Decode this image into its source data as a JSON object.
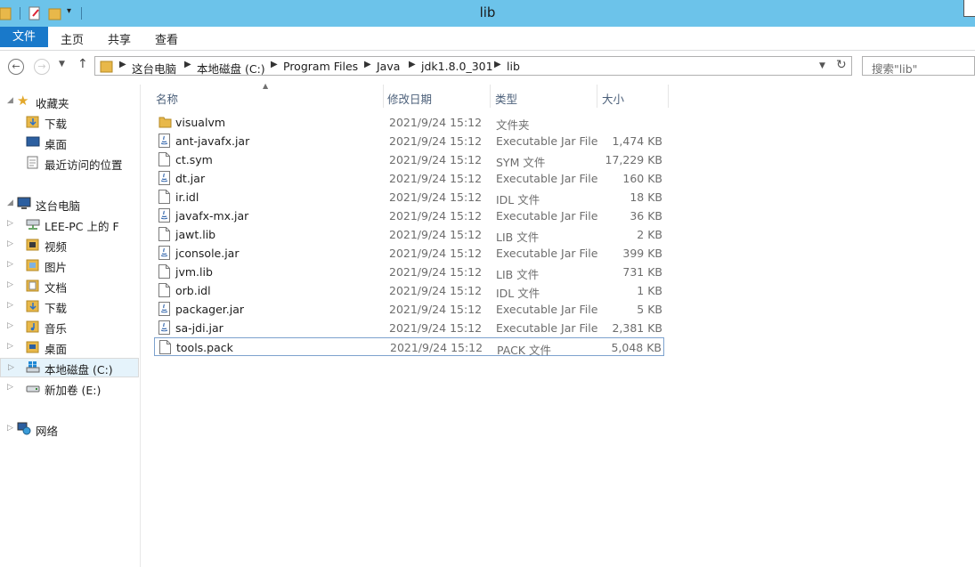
{
  "window": {
    "title": "lib"
  },
  "ribbon": {
    "tabs": [
      "文件",
      "主页",
      "共享",
      "查看"
    ]
  },
  "address": {
    "crumbs": [
      "这台电脑",
      "本地磁盘 (C:)",
      "Program Files",
      "Java",
      "jdk1.8.0_301",
      "lib"
    ]
  },
  "search": {
    "placeholder": "搜索\"lib\""
  },
  "nav": {
    "items": [
      {
        "label": "收藏夹",
        "icon": "star-icon"
      },
      {
        "label": "下载",
        "icon": "downloads-folder-icon"
      },
      {
        "label": "桌面",
        "icon": "desktop-icon"
      },
      {
        "label": "最近访问的位置",
        "icon": "recent-places-icon"
      },
      {
        "label": "这台电脑",
        "icon": "computer-icon"
      },
      {
        "label": "LEE-PC 上的 F",
        "icon": "network-drive-icon"
      },
      {
        "label": "视频",
        "icon": "videos-folder-icon"
      },
      {
        "label": "图片",
        "icon": "pictures-folder-icon"
      },
      {
        "label": "文档",
        "icon": "documents-folder-icon"
      },
      {
        "label": "下载",
        "icon": "downloads-folder-icon"
      },
      {
        "label": "音乐",
        "icon": "music-folder-icon"
      },
      {
        "label": "桌面",
        "icon": "desktop-folder-icon"
      },
      {
        "label": "本地磁盘 (C:)",
        "icon": "local-disk-icon"
      },
      {
        "label": "新加卷 (E:)",
        "icon": "drive-icon"
      },
      {
        "label": "网络",
        "icon": "network-icon"
      }
    ]
  },
  "columns": {
    "name": "名称",
    "date": "修改日期",
    "type": "类型",
    "size": "大小"
  },
  "files": [
    {
      "name": "visualvm",
      "date": "2021/9/24 15:12",
      "type": "文件夹",
      "size": "",
      "icon": "folder-icon"
    },
    {
      "name": "ant-javafx.jar",
      "date": "2021/9/24 15:12",
      "type": "Executable Jar File",
      "size": "1,474 KB",
      "icon": "jar-icon"
    },
    {
      "name": "ct.sym",
      "date": "2021/9/24 15:12",
      "type": "SYM 文件",
      "size": "17,229 KB",
      "icon": "file-icon"
    },
    {
      "name": "dt.jar",
      "date": "2021/9/24 15:12",
      "type": "Executable Jar File",
      "size": "160 KB",
      "icon": "jar-icon"
    },
    {
      "name": "ir.idl",
      "date": "2021/9/24 15:12",
      "type": "IDL 文件",
      "size": "18 KB",
      "icon": "file-icon"
    },
    {
      "name": "javafx-mx.jar",
      "date": "2021/9/24 15:12",
      "type": "Executable Jar File",
      "size": "36 KB",
      "icon": "jar-icon"
    },
    {
      "name": "jawt.lib",
      "date": "2021/9/24 15:12",
      "type": "LIB 文件",
      "size": "2 KB",
      "icon": "file-icon"
    },
    {
      "name": "jconsole.jar",
      "date": "2021/9/24 15:12",
      "type": "Executable Jar File",
      "size": "399 KB",
      "icon": "jar-icon"
    },
    {
      "name": "jvm.lib",
      "date": "2021/9/24 15:12",
      "type": "LIB 文件",
      "size": "731 KB",
      "icon": "file-icon"
    },
    {
      "name": "orb.idl",
      "date": "2021/9/24 15:12",
      "type": "IDL 文件",
      "size": "1 KB",
      "icon": "file-icon"
    },
    {
      "name": "packager.jar",
      "date": "2021/9/24 15:12",
      "type": "Executable Jar File",
      "size": "5 KB",
      "icon": "jar-icon"
    },
    {
      "name": "sa-jdi.jar",
      "date": "2021/9/24 15:12",
      "type": "Executable Jar File",
      "size": "2,381 KB",
      "icon": "jar-icon"
    },
    {
      "name": "tools.pack",
      "date": "2021/9/24 15:12",
      "type": "PACK 文件",
      "size": "5,048 KB",
      "icon": "file-icon",
      "selected": true
    }
  ]
}
